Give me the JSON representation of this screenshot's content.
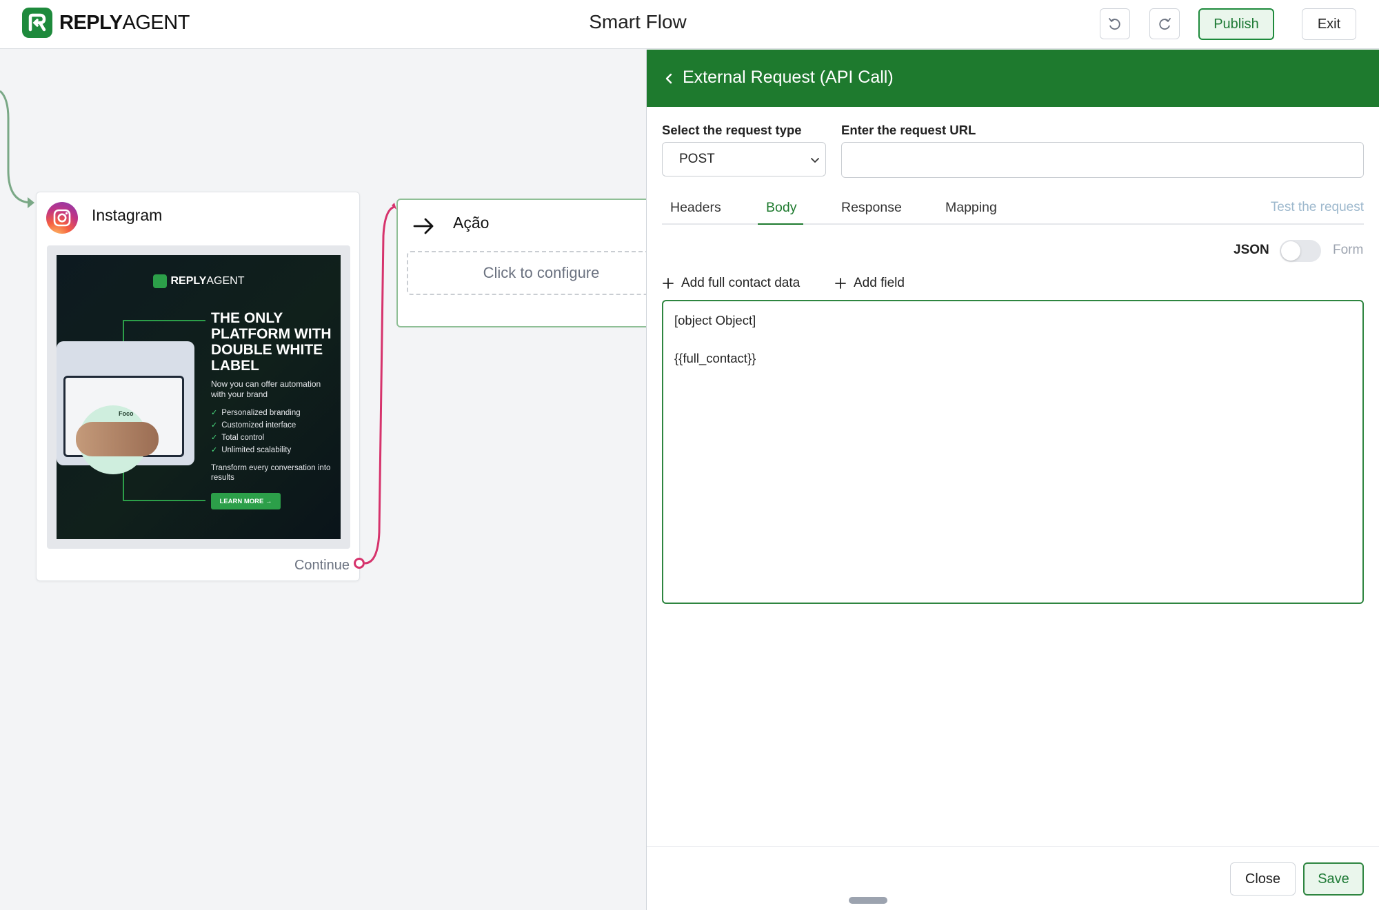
{
  "header": {
    "brand_bold": "REPLY",
    "brand_light": "AGENT",
    "title": "Smart Flow",
    "publish_label": "Publish",
    "exit_label": "Exit",
    "undo_icon": "undo-icon",
    "redo_icon": "redo-icon"
  },
  "canvas": {
    "instagram_node": {
      "title": "Instagram",
      "continue_label": "Continue",
      "promo": {
        "brand_bold": "REPLY",
        "brand_light": "AGENT",
        "headline": "THE ONLY PLATFORM WITH DOUBLE WHITE LABEL",
        "subtitle": "Now you can offer automation with your brand",
        "features": [
          "Personalized branding",
          "Customized interface",
          "Total control",
          "Unlimited scalability"
        ],
        "footer": "Transform every conversation into results",
        "cta": "LEARN MORE →",
        "device_label": "Foco"
      }
    },
    "action_node": {
      "title": "Ação",
      "placeholder": "Click to configure"
    }
  },
  "panel": {
    "title": "External Request (API Call)",
    "request_type_label": "Select the request type",
    "request_type_value": "POST",
    "request_type_options": [
      "POST"
    ],
    "url_label": "Enter the request URL",
    "url_value": "",
    "tabs": [
      "Headers",
      "Body",
      "Response",
      "Mapping"
    ],
    "active_tab": "Body",
    "test_link": "Test the request",
    "json_label": "JSON",
    "form_label": "Form",
    "body_mode_json": true,
    "add_contact_label": "Add full contact data",
    "add_field_label": "Add field",
    "body_text": "[object Object]\n\n{{full_contact}}",
    "close_label": "Close",
    "save_label": "Save"
  },
  "colors": {
    "brand_green": "#1e7a2e",
    "instagram_edge": "#d6336c",
    "inbound_edge": "#7aa886"
  }
}
